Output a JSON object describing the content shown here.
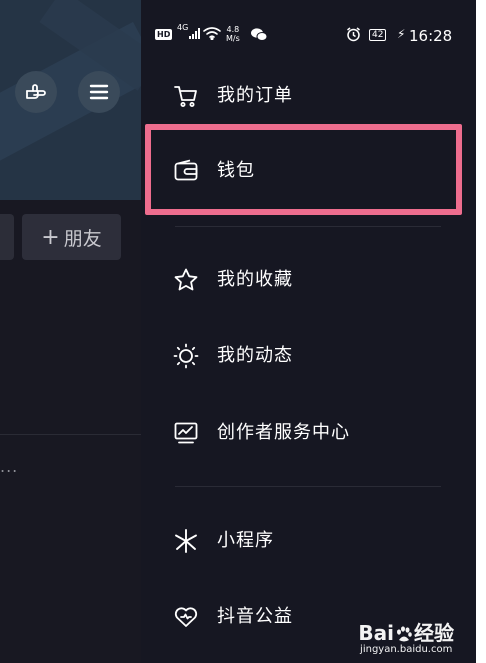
{
  "status_bar": {
    "network_badge": "HD",
    "signal_type": "4G",
    "speed_value": "4.8",
    "speed_unit": "M/s",
    "battery": "42",
    "time": "16:28"
  },
  "background": {
    "friend_button_plus": "+",
    "friend_button_label": "朋友",
    "ellipsis": "..."
  },
  "menu": {
    "items": [
      {
        "label": "我的订单",
        "icon": "shopping-cart-icon"
      },
      {
        "label": "钱包",
        "icon": "wallet-icon"
      },
      {
        "label": "我的收藏",
        "icon": "star-icon"
      },
      {
        "label": "我的动态",
        "icon": "sun-icon"
      },
      {
        "label": "创作者服务中心",
        "icon": "chart-monitor-icon"
      },
      {
        "label": "小程序",
        "icon": "mini-program-icon"
      },
      {
        "label": "抖音公益",
        "icon": "heart-icon"
      }
    ]
  },
  "highlight": {
    "color": "#ee6d8e",
    "target": "钱包"
  },
  "watermark": {
    "brand_prefix": "Bai",
    "brand_suffix": "经验",
    "url": "jingyan.baidu.com"
  },
  "colors": {
    "drawer_bg": "#161722",
    "header_bg": "#253445",
    "text": "#ffffff"
  }
}
